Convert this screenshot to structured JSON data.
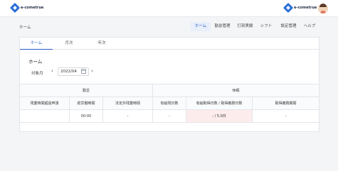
{
  "header": {
    "logo_left": "e-cometrue",
    "logo_right": "e-cometrue",
    "nav": [
      "ホーム",
      "勤怠管理",
      "打刻実績",
      "シフト",
      "設定管理",
      "ヘルプ"
    ]
  },
  "breadcrumb": "ホーム",
  "tabs": [
    "ホーム",
    "月次",
    "年次"
  ],
  "section_title": "ホーム",
  "month": {
    "label": "対象月",
    "value": "2022/04"
  },
  "table": {
    "groups": [
      "勤怠",
      "休暇"
    ],
    "columns": [
      "残業時間超過申請",
      "総労働時間",
      "法定外残業時間",
      "有給残日数",
      "有給取得日数 / 取得義務日数",
      "取得義務期間"
    ],
    "row": [
      "",
      "00:00",
      "-",
      "-",
      "- / 5.0日",
      "-"
    ]
  },
  "colors": {
    "accent": "#2b5cc4",
    "highlight": "#fdecec"
  }
}
